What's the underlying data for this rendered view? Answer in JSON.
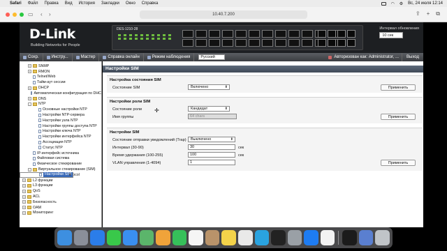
{
  "macos_menu": {
    "items": [
      "Safari",
      "Файл",
      "Правка",
      "Вид",
      "История",
      "Закладки",
      "Окно",
      "Справка"
    ],
    "clock": "Вс, 24 июля  12:14"
  },
  "browser": {
    "address": "10.40.7.200"
  },
  "header": {
    "logo": "D-Link",
    "tagline": "Building Networks for People",
    "model": "DES-1210-28",
    "refresh_label": "Интервал обновления",
    "refresh_value": "10 сек"
  },
  "navbar": {
    "save": "Сохр.",
    "tools": "Инстру...",
    "wizard": "Мастер",
    "help": "Справка онлайн",
    "monitor": "Режим наблюдения",
    "language": "Русский",
    "user": "Авторизован как: Administrator, ...",
    "logout": "Выход"
  },
  "tree": [
    {
      "label": "SNMP",
      "indent": 1,
      "kind": "folder",
      "exp": "+"
    },
    {
      "label": "RMON",
      "indent": 1,
      "kind": "folder",
      "exp": "+"
    },
    {
      "label": "Telnet/Web",
      "indent": 1,
      "kind": "page",
      "exp": ""
    },
    {
      "label": "Тайм-аут сессии",
      "indent": 1,
      "kind": "page",
      "exp": ""
    },
    {
      "label": "DHCP",
      "indent": 1,
      "kind": "folder",
      "exp": "+"
    },
    {
      "label": "Автоматическая конфигурация по DHC",
      "indent": 1,
      "kind": "page",
      "exp": ""
    },
    {
      "label": "DNS",
      "indent": 1,
      "kind": "folder",
      "exp": "+"
    },
    {
      "label": "NTP",
      "indent": 1,
      "kind": "folder",
      "exp": "-"
    },
    {
      "label": "Основные настройки NTP",
      "indent": 2,
      "kind": "page",
      "exp": ""
    },
    {
      "label": "Настройки NTP-сервера",
      "indent": 2,
      "kind": "page",
      "exp": ""
    },
    {
      "label": "Настройки узла NTP",
      "indent": 2,
      "kind": "page",
      "exp": ""
    },
    {
      "label": "Настройки группы доступа NTP",
      "indent": 2,
      "kind": "page",
      "exp": ""
    },
    {
      "label": "Настройки ключа NTP",
      "indent": 2,
      "kind": "page",
      "exp": ""
    },
    {
      "label": "Настройки интерфейса NTP",
      "indent": 2,
      "kind": "page",
      "exp": ""
    },
    {
      "label": "Ассоциация NTP",
      "indent": 2,
      "kind": "page",
      "exp": ""
    },
    {
      "label": "Статус NTP",
      "indent": 2,
      "kind": "page",
      "exp": ""
    },
    {
      "label": "IP-интерфейс источника",
      "indent": 1,
      "kind": "page",
      "exp": ""
    },
    {
      "label": "Файловая система",
      "indent": 1,
      "kind": "page",
      "exp": ""
    },
    {
      "label": "Физическое стекирование",
      "indent": 1,
      "kind": "page",
      "exp": ""
    },
    {
      "label": "Виртуальное стекирование (SIM)",
      "indent": 1,
      "kind": "folder",
      "exp": "-"
    },
    {
      "label": "Настройки SIM",
      "indent": 2,
      "kind": "page",
      "exp": "",
      "selected": true
    },
    {
      "label": "D-Link Discovery Protocol",
      "indent": 1,
      "kind": "page",
      "exp": ""
    },
    {
      "label": "L2 функции",
      "indent": 0,
      "kind": "folder",
      "exp": "+"
    },
    {
      "label": "L3 функции",
      "indent": 0,
      "kind": "folder",
      "exp": "+"
    },
    {
      "label": "QoS",
      "indent": 0,
      "kind": "folder",
      "exp": "+"
    },
    {
      "label": "ACL",
      "indent": 0,
      "kind": "folder",
      "exp": "+"
    },
    {
      "label": "Безопасность",
      "indent": 0,
      "kind": "folder",
      "exp": "+"
    },
    {
      "label": "OAM",
      "indent": 0,
      "kind": "folder",
      "exp": "+"
    },
    {
      "label": "Мониторинг",
      "indent": 0,
      "kind": "folder",
      "exp": "+"
    }
  ],
  "content": {
    "title": "Настройки SIM",
    "state": {
      "heading": "Настройка состояния SIM",
      "label": "Состояние SIM",
      "value": "Включено",
      "apply": "Применить"
    },
    "role": {
      "heading": "Настройки роли SIM",
      "role_label": "Состояние роли",
      "role_value": "Кандидат",
      "group_label": "Имя группы",
      "group_value": "64 chars",
      "apply": "Применить"
    },
    "sim": {
      "heading": "Настройки SIM",
      "trap_label": "Состояние отправки уведомлений (Trap)",
      "trap_value": "Выключено",
      "interval_label": "Интервал (30-90)",
      "interval_value": "30",
      "interval_unit": "сек",
      "hold_label": "Время удержания (100-255)",
      "hold_value": "100",
      "hold_unit": "сек",
      "vlan_label": "VLAN управления (1-4094)",
      "vlan_value": "1",
      "apply": "Применить"
    }
  },
  "dock_apps": [
    "Finder",
    "Launchpad",
    "Safari",
    "Messages",
    "Mail",
    "Maps",
    "Photos",
    "FaceTime",
    "Calendar",
    "Contacts",
    "Notes",
    "Chrome",
    "Telegram",
    "Terminal",
    "Settings",
    "App Store",
    "Notes2",
    "Terminal2",
    "Preview",
    "Trash"
  ]
}
